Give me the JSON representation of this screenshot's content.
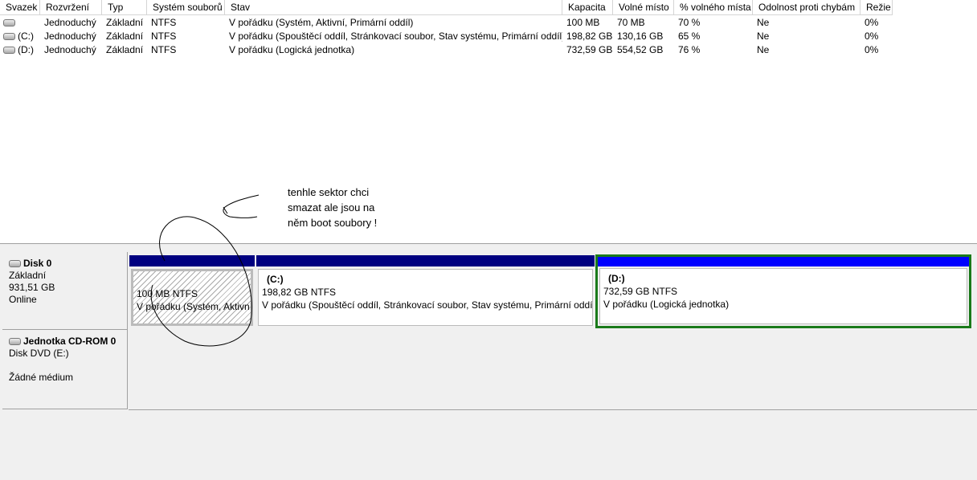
{
  "columns": [
    "Svazek",
    "Rozvržení",
    "Typ",
    "Systém souborů",
    "Stav",
    "Kapacita",
    "Volné místo",
    "% volného místa",
    "Odolnost proti chybám",
    "Režie"
  ],
  "volumes": [
    [
      "",
      "Jednoduchý",
      "Základní",
      "NTFS",
      "V pořádku (Systém, Aktivní, Primární oddíl)",
      "100 MB",
      "70 MB",
      "70 %",
      "Ne",
      "0%"
    ],
    [
      "(C:)",
      "Jednoduchý",
      "Základní",
      "NTFS",
      "V pořádku (Spouštěcí oddíl, Stránkovací soubor, Stav systému, Primární oddíl)",
      "198,82 GB",
      "130,16 GB",
      "65 %",
      "Ne",
      "0%"
    ],
    [
      "(D:)",
      "Jednoduchý",
      "Základní",
      "NTFS",
      "V pořádku (Logická jednotka)",
      "732,59 GB",
      "554,52 GB",
      "76 %",
      "Ne",
      "0%"
    ]
  ],
  "annotation": [
    "tenhle sektor chci",
    "smazat ale jsou na",
    "něm boot soubory !"
  ],
  "disk0": {
    "name": "Disk 0",
    "type": "Základní",
    "size": "931,51 GB",
    "status": "Online",
    "partitions": [
      {
        "label": "",
        "size": "100 MB NTFS",
        "status": "V pořádku (Systém, Aktivní"
      },
      {
        "label": "(C:)",
        "size": "198,82 GB NTFS",
        "status": "V pořádku (Spouštěcí oddíl, Stránkovací soubor, Stav systému, Primární oddíl"
      },
      {
        "label": "(D:)",
        "size": "732,59 GB NTFS",
        "status": "V pořádku (Logická jednotka)"
      }
    ]
  },
  "cdrom": {
    "name": "Jednotka CD-ROM 0",
    "type": "Disk DVD (E:)",
    "status": "Žádné médium"
  },
  "colors": {
    "primary_bar": "#000080",
    "logical_bar": "#0000ff",
    "selected_border": "#1a7a1a"
  }
}
